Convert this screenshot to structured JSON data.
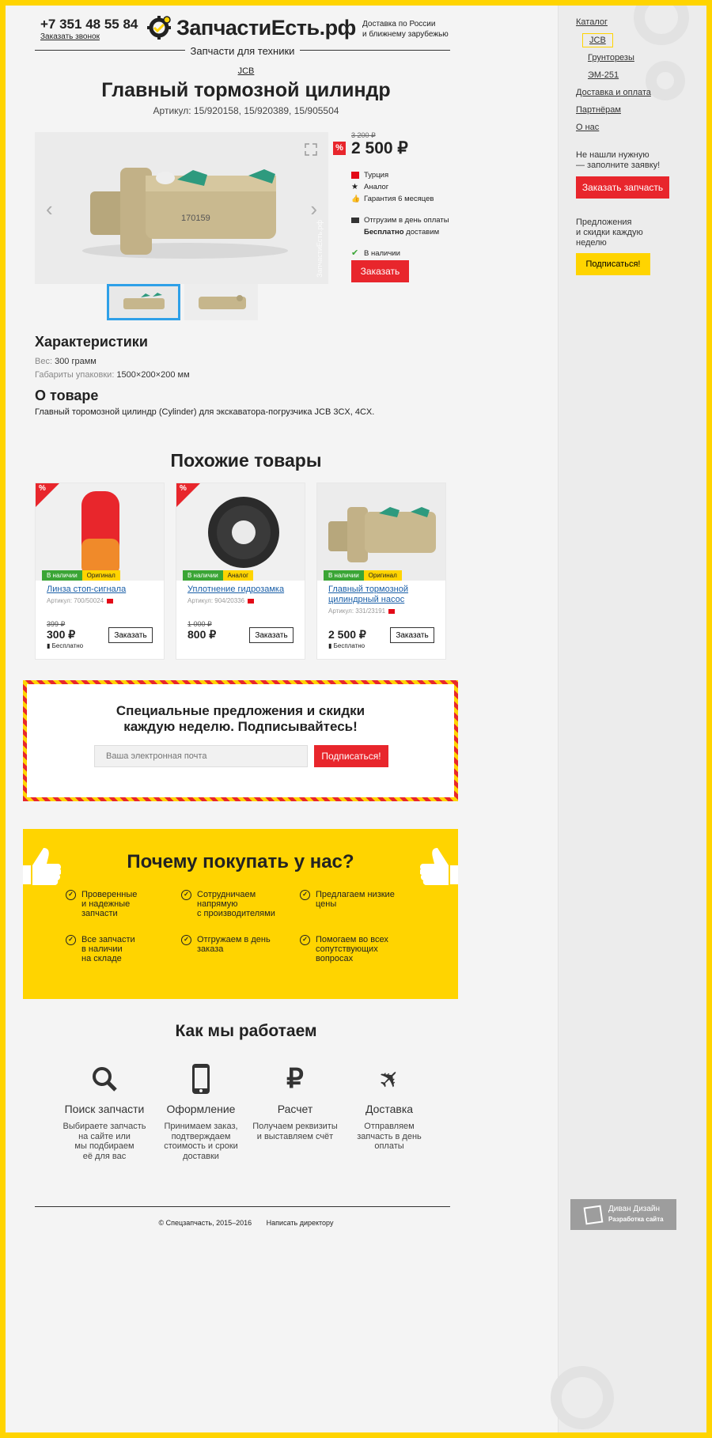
{
  "header": {
    "phone": "+7 351 48 55 84",
    "callback": "Заказать звонок",
    "logo": "ЗапчастиЕсть.рф",
    "delivery_line1": "Доставка по России",
    "delivery_line2": "и ближнему зарубежью",
    "tagline": "Запчасти для техники"
  },
  "product": {
    "breadcrumb": "JCB",
    "title": "Главный тормозной цилиндр",
    "articul": "Артикул: 15/920158, 15/920389, 15/905504",
    "watermark": "ЗапчастиЕсть.рф",
    "old_price": "3 200 ₽",
    "sale_badge": "%",
    "price": "2 500 ₽",
    "country": "Турция",
    "kind": "Аналог",
    "warranty": "Гарантия 6 месяцев",
    "ship": "Отгрузим в день оплаты",
    "free_bold": "Бесплатно",
    "free_rest": " доставим",
    "stock": "В наличии",
    "order": "Заказать"
  },
  "specs": {
    "title": "Характеристики",
    "weight_key": "Вес:",
    "weight_val": " 300 грамм",
    "size_key": "Габариты упаковки:",
    "size_val": " 1500×200×200 мм",
    "about_title": "О товаре",
    "about_text": "Главный торомозной цилиндр (Cylinder) для экскаватора-погрузчика JCB 3CX, 4CX."
  },
  "similar": {
    "title": "Похожие товары",
    "items": [
      {
        "name": "Линза стоп-сигнала",
        "art": "Артикул: 700/50024",
        "old": "399 ₽",
        "price": "300 ₽",
        "free": "Бесплатно",
        "tag1": "В наличии",
        "tag2": "Оригинал",
        "btn": "Заказать",
        "sale": "%"
      },
      {
        "name": "Уплотнение гидрозамка",
        "art": "Артикул: 904/20336",
        "old": "1 000 ₽",
        "price": "800 ₽",
        "free": "",
        "tag1": "В наличии",
        "tag2": "Аналог",
        "btn": "Заказать",
        "sale": "%"
      },
      {
        "name": "Главный тормозной цилиндрный насос",
        "art": "Артикул: 331/23191",
        "old": "",
        "price": "2 500 ₽",
        "free": "Бесплатно",
        "tag1": "В наличии",
        "tag2": "Оригинал",
        "btn": "Заказать",
        "sale": ""
      }
    ]
  },
  "subscribe": {
    "line1": "Специальные предложения и скидки",
    "line2": "каждую неделю. Подписывайтесь!",
    "placeholder": "Ваша электронная почта",
    "button": "Подписаться!"
  },
  "why": {
    "title": "Почему покупать у нас?",
    "items": [
      [
        "Проверенные",
        "и надежные запчасти",
        ""
      ],
      [
        "Сотрудничаем",
        "напрямую",
        "с производителями"
      ],
      [
        "Предлагаем низкие",
        "цены",
        ""
      ],
      [
        "Все запчасти",
        "в наличии",
        "на складе"
      ],
      [
        "Отгружаем в день",
        "заказа",
        ""
      ],
      [
        "Помогаем во всех",
        "сопутствующих",
        "вопросах"
      ]
    ]
  },
  "how": {
    "title": "Как мы работаем",
    "steps": [
      {
        "t": "Поиск запчасти",
        "d1": "Выбираете запчасть",
        "d2": "на сайте или",
        "d3": "мы подбираем",
        "d4": "её для вас",
        "icon": "search-icon"
      },
      {
        "t": "Оформление",
        "d1": "Принимаем заказ,",
        "d2": "подтверждаем",
        "d3": "стоимость и сроки",
        "d4": "доставки",
        "icon": "phone-icon"
      },
      {
        "t": "Расчет",
        "d1": "Получаем реквизиты",
        "d2": "и выставляем счёт",
        "d3": "",
        "d4": "",
        "icon": "ruble-icon"
      },
      {
        "t": "Доставка",
        "d1": "Отправляем",
        "d2": "запчасть в день",
        "d3": "оплаты",
        "d4": "",
        "icon": "plane-icon"
      }
    ]
  },
  "footer": {
    "copy": "© Спецзапчасть, 2015–2016",
    "link": "Написать директору"
  },
  "sidebar": {
    "catalog": "Каталог",
    "jcb": "JCB",
    "grunt": "Грунторезы",
    "em": "ЭМ-251",
    "delivery": "Доставка и оплата",
    "partners": "Партнёрам",
    "about": "О нас",
    "note1": "Не нашли нужную",
    "note2": "— заполните заявку!",
    "order_part": "Заказать запчасть",
    "offer1": "Предложения",
    "offer2": "и скидки каждую",
    "offer3": "неделю",
    "subscribe": "Подписаться!",
    "dev_title": "Диван Дизайн",
    "dev_sub": "Разработка сайта"
  },
  "colors": {
    "accent": "#ffd400",
    "red": "#e8262c",
    "green": "#3aa535",
    "link": "#1a5fa8"
  }
}
